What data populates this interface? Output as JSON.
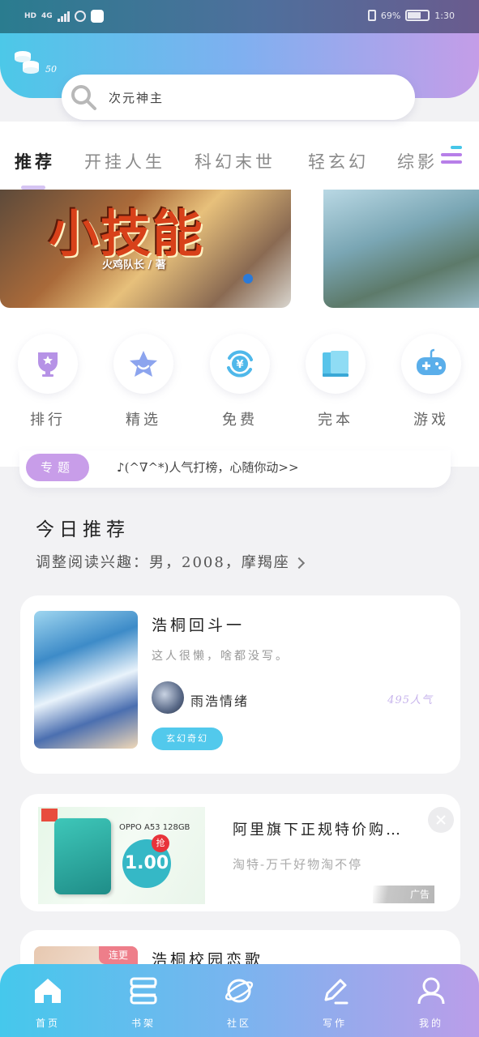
{
  "status_bar": {
    "network": "4G",
    "hd": "HD",
    "battery": "69%",
    "time": "1:30"
  },
  "header": {
    "coin_count": "50",
    "search_placeholder": "次元神主"
  },
  "tabs": [
    "推荐",
    "开挂人生",
    "科幻末世",
    "轻玄幻",
    "综影"
  ],
  "banner": {
    "title": "小技能",
    "author": "火鸡队长 / 著"
  },
  "categories": [
    {
      "label": "排行",
      "icon": "trophy-icon"
    },
    {
      "label": "精选",
      "icon": "star-icon"
    },
    {
      "label": "免费",
      "icon": "yuan-icon"
    },
    {
      "label": "完本",
      "icon": "book-icon"
    },
    {
      "label": "游戏",
      "icon": "gamepad-icon"
    }
  ],
  "notice": {
    "badge": "专题",
    "text": "♪(^∇^*)人气打榜，心随你动>>"
  },
  "section": {
    "title": "今日推荐",
    "interest": "调整阅读兴趣：男，2008，摩羯座"
  },
  "book1": {
    "title": "浩桐回斗一",
    "desc": "这人很懒，啥都没写。",
    "author": "雨浩情绪",
    "popularity": "495人气",
    "genre": "玄幻奇幻"
  },
  "ad": {
    "model": "OPPO A53 128GB",
    "price": "1.00",
    "grab": "抢",
    "title": "阿里旗下正规特价购…",
    "subtitle": "淘特-万千好物淘不停",
    "badge": "广告"
  },
  "book3": {
    "title": "浩桐校园恋歌",
    "tag": "连更"
  },
  "bottom_nav": [
    {
      "label": "首页",
      "icon": "home-icon"
    },
    {
      "label": "书架",
      "icon": "bookshelf-icon"
    },
    {
      "label": "社区",
      "icon": "planet-icon"
    },
    {
      "label": "写作",
      "icon": "pen-icon"
    },
    {
      "label": "我的",
      "icon": "user-icon"
    }
  ],
  "colors": {
    "accent_cyan": "#4cc8e8",
    "accent_purple": "#c49de8",
    "tag_blue": "#52c9ec",
    "badge_purple": "#c89de9"
  }
}
